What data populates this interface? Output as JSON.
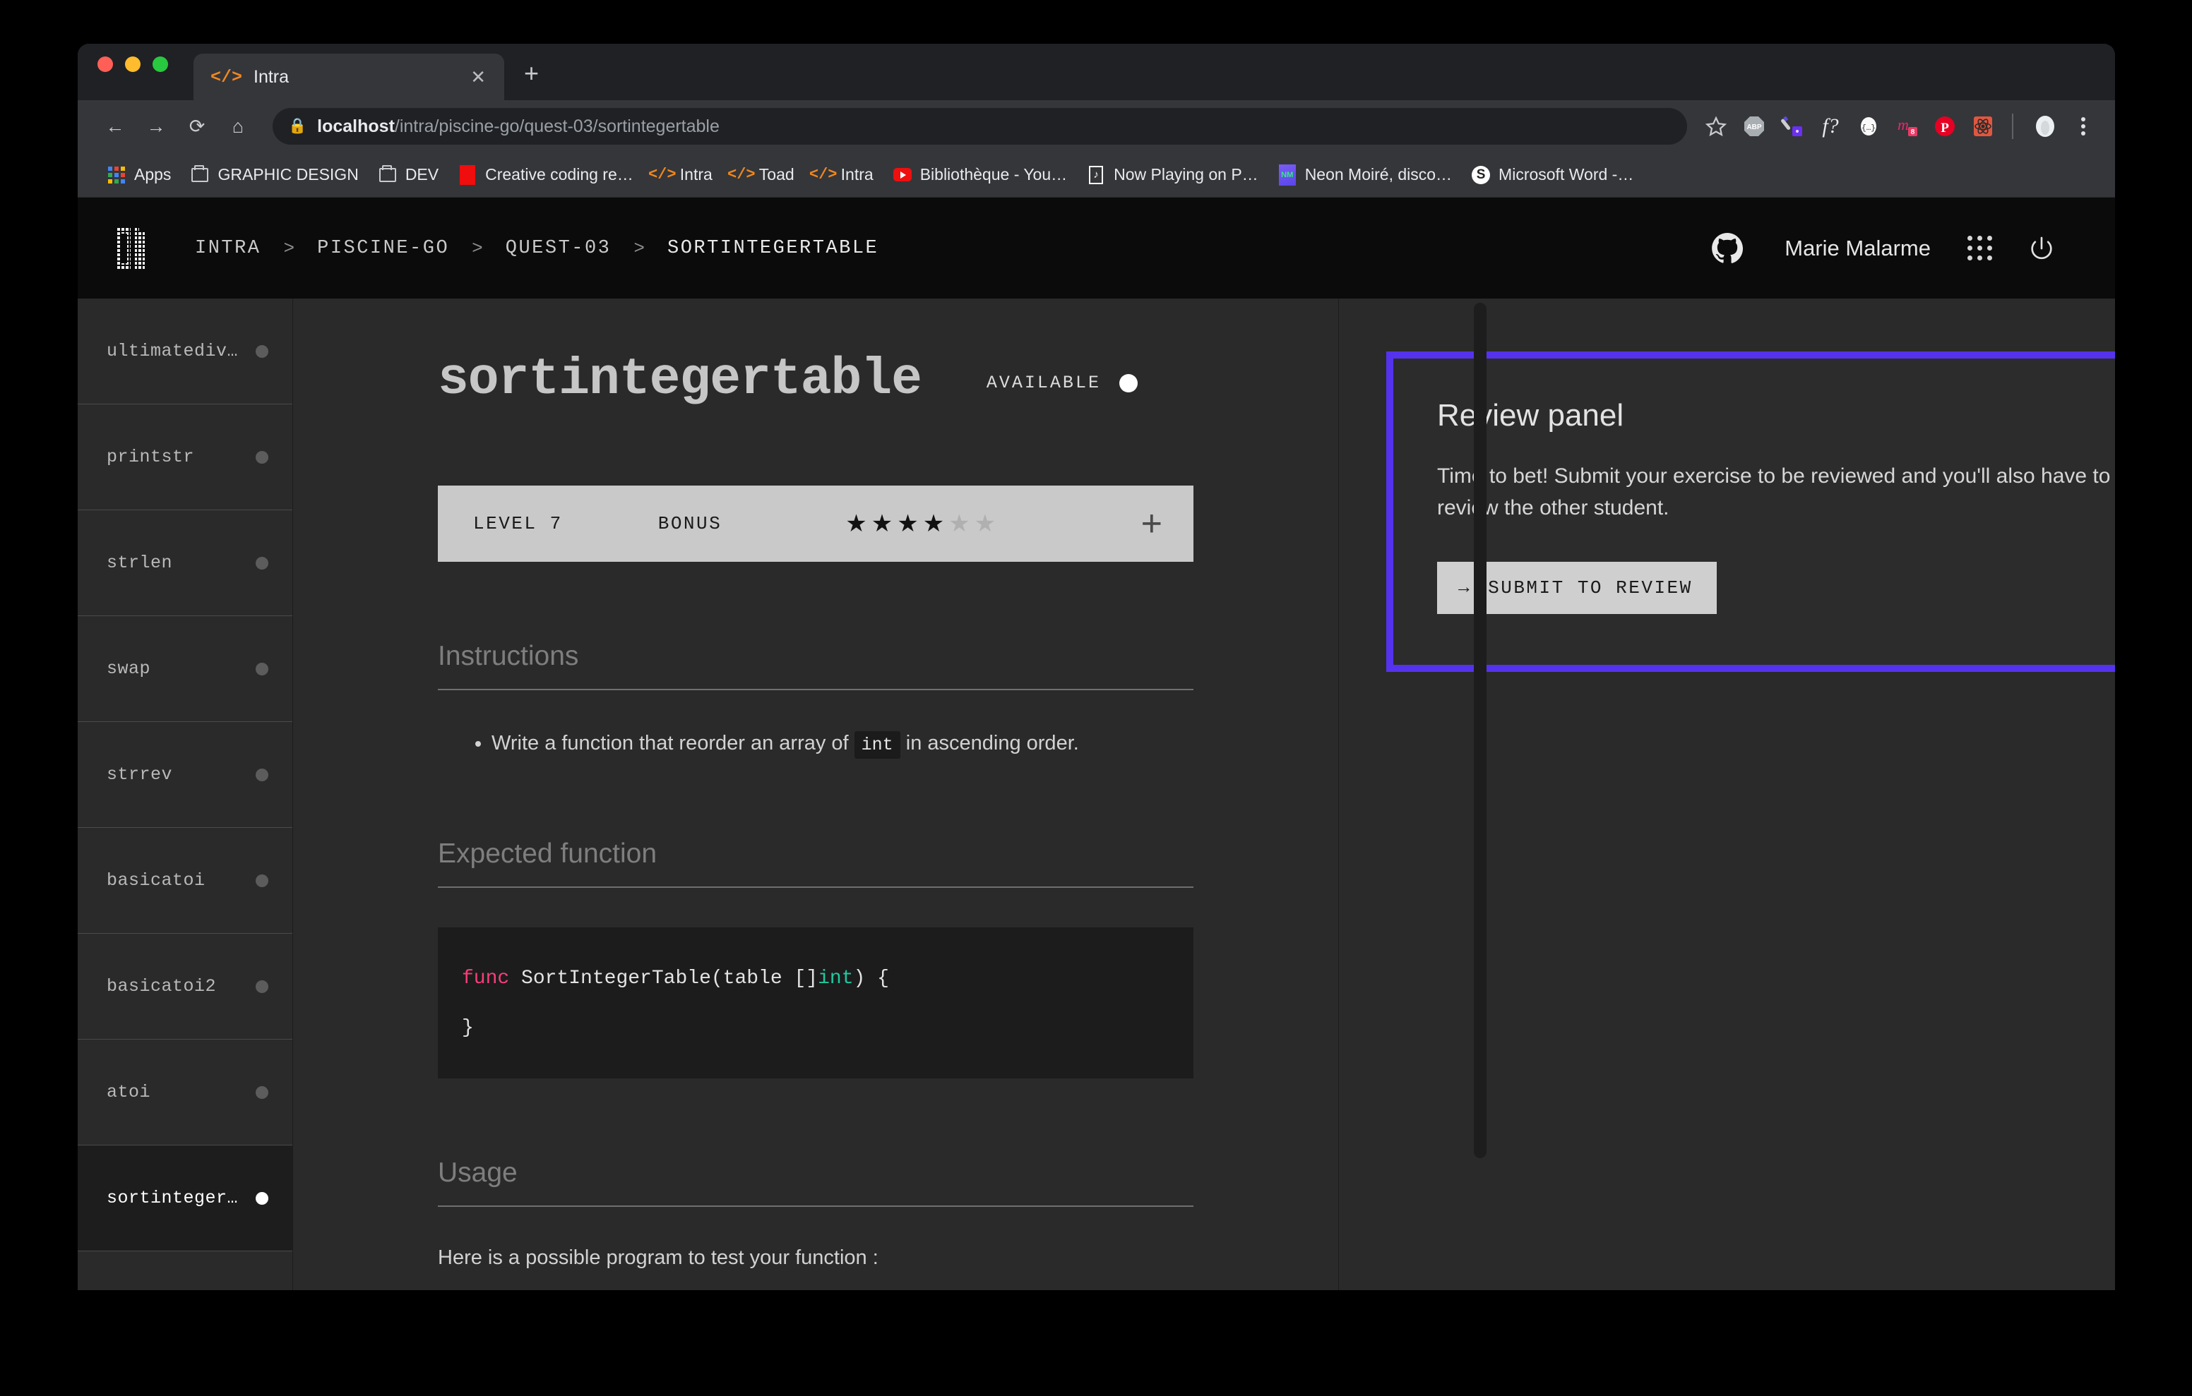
{
  "browser": {
    "tab": {
      "title": "Intra",
      "favicon_icon": "code-brackets-icon",
      "close_icon": "close-icon"
    },
    "new_tab_label": "+",
    "nav": {
      "back_icon": "arrow-left-icon",
      "forward_icon": "arrow-right-icon",
      "reload_icon": "reload-icon",
      "home_icon": "home-icon"
    },
    "omnibox": {
      "lock_icon": "lock-icon",
      "url_host": "localhost",
      "url_path": "/intra/piscine-go/quest-03/sortintegertable",
      "bookmark_icon": "star-icon"
    },
    "extensions": [
      {
        "name": "adblock-plus-icon",
        "label": "ABP"
      },
      {
        "name": "eyedropper-icon",
        "label": ""
      },
      {
        "name": "font-finder-icon",
        "label": "f?"
      },
      {
        "name": "json-viewer-icon",
        "label": "{…}"
      },
      {
        "name": "momentum-icon",
        "label": "8"
      },
      {
        "name": "pinterest-icon",
        "label": "P"
      },
      {
        "name": "react-devtools-icon",
        "label": ""
      }
    ],
    "profile_icon": "profile-avatar-icon",
    "menu_icon": "three-dot-menu-icon",
    "bookmarks": [
      {
        "label": "Apps",
        "icon": "apps-grid-icon"
      },
      {
        "label": "GRAPHIC DESIGN",
        "icon": "folder-icon"
      },
      {
        "label": "DEV",
        "icon": "folder-icon"
      },
      {
        "label": "Creative coding re…",
        "icon": "red-square-icon"
      },
      {
        "label": "Intra",
        "icon": "code-brackets-icon"
      },
      {
        "label": "Toad",
        "icon": "code-brackets-icon"
      },
      {
        "label": "Intra",
        "icon": "code-brackets-icon"
      },
      {
        "label": "Bibliothèque - You…",
        "icon": "youtube-icon"
      },
      {
        "label": "Now Playing on P…",
        "icon": "now-playing-icon"
      },
      {
        "label": "Neon Moiré, disco…",
        "icon": "neon-moire-icon"
      },
      {
        "label": "Microsoft Word -…",
        "icon": "microsoft-word-icon"
      }
    ]
  },
  "app": {
    "logo_icon": "pixel-01-logo",
    "breadcrumbs": [
      "INTRA",
      "PISCINE-GO",
      "QUEST-03",
      "SORTINTEGERTABLE"
    ],
    "breadcrumb_separator": ">",
    "github_icon": "github-icon",
    "username": "Marie Malarme",
    "apps_grid_icon": "grid-dots-icon",
    "power_icon": "power-icon"
  },
  "sidebar": {
    "items": [
      {
        "label": "ultimatediv…",
        "active": false
      },
      {
        "label": "printstr",
        "active": false
      },
      {
        "label": "strlen",
        "active": false
      },
      {
        "label": "swap",
        "active": false
      },
      {
        "label": "strrev",
        "active": false
      },
      {
        "label": "basicatoi",
        "active": false
      },
      {
        "label": "basicatoi2",
        "active": false
      },
      {
        "label": "atoi",
        "active": false
      },
      {
        "label": "sortinteger…",
        "active": true
      }
    ]
  },
  "exercise": {
    "title": "sortintegertable",
    "status": "AVAILABLE",
    "level_label": "LEVEL 7",
    "bonus_label": "BONUS",
    "stars_filled": 4,
    "stars_total": 6,
    "expand_label": "+",
    "sections": {
      "instructions_title": "Instructions",
      "instruction_text_before": "Write a function that reorder an array of",
      "instruction_code": "int",
      "instruction_text_after": "in ascending order.",
      "expected_function_title": "Expected function",
      "code_keyword": "func",
      "code_signature": " SortIntegerTable(table []",
      "code_type": "int",
      "code_tail": ") {",
      "code_close": "}",
      "usage_title": "Usage",
      "usage_text": "Here is a possible program to test your function :"
    }
  },
  "review_panel": {
    "title": "Review panel",
    "description": "Time to bet! Submit your exercise to be reviewed and you'll also have to review the other student.",
    "button_arrow": "→",
    "button_label": "SUBMIT TO REVIEW",
    "border_color": "#5533ee"
  }
}
